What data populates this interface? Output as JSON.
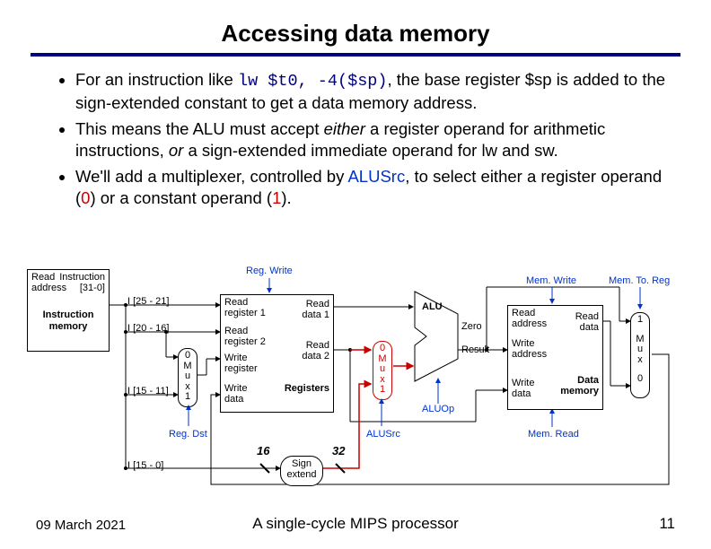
{
  "title": "Accessing data memory",
  "bullet1_a": "For an instruction like ",
  "bullet1_code": "lw $t0, -4($sp)",
  "bullet1_b": ", the base register $sp is added to the sign-extended constant to get a data memory address.",
  "bullet2_a": "This means the ALU must accept ",
  "bullet2_i1": "either",
  "bullet2_b": " a register operand for arithmetic instructions, ",
  "bullet2_i2": "or",
  "bullet2_c": " a sign-extended immediate operand for lw and sw.",
  "bullet3_a": "We'll add a multiplexer, controlled by ",
  "bullet3_ctrl": "ALUSrc",
  "bullet3_b": ", to select either a register operand (",
  "bullet3_zero": "0",
  "bullet3_c": ") or a constant operand (",
  "bullet3_one": "1",
  "bullet3_d": ").",
  "im_readaddr": "Read",
  "im_addr2": "address",
  "im_instr": "Instruction",
  "im_bits": "[31-0]",
  "im_name1": "Instruction",
  "im_name2": "memory",
  "field_rs": "I [25 - 21]",
  "field_rt": "I [20 - 16]",
  "field_rd": "I [15 - 11]",
  "field_imm": "I [15 - 0]",
  "regdst_mux0": "0",
  "regdst_muxM": "M",
  "regdst_muxu": "u",
  "regdst_muxx": "x",
  "regdst_mux1": "1",
  "alusrc_mux0": "0",
  "alusrc_mux1": "1",
  "memreg_mux0": "0",
  "memreg_mux1": "1",
  "rf_rr1": "Read",
  "rf_rr1b": "register 1",
  "rf_rr2": "Read",
  "rf_rr2b": "register 2",
  "rf_wr": "Write",
  "rf_wrb": "register",
  "rf_wd": "Write",
  "rf_wdb": "data",
  "rf_rd1": "Read",
  "rf_rd1b": "data 1",
  "rf_rd2": "Read",
  "rf_rd2b": "data 2",
  "rf_name": "Registers",
  "se_name": "Sign",
  "se_name2": "extend",
  "se_in": "16",
  "se_out": "32",
  "alu_name": "ALU",
  "alu_zero": "Zero",
  "alu_res": "Result",
  "dm_ra": "Read",
  "dm_ra2": "address",
  "dm_wa": "Write",
  "dm_wa2": "address",
  "dm_wd": "Write",
  "dm_wd2": "data",
  "dm_rd": "Read",
  "dm_rd2": "data",
  "dm_name": "Data",
  "dm_name2": "memory",
  "ctrl_regwrite": "Reg. Write",
  "ctrl_regdst": "Reg. Dst",
  "ctrl_alusrc": "ALUSrc",
  "ctrl_aluop": "ALUOp",
  "ctrl_memwrite": "Mem. Write",
  "ctrl_memread": "Mem. Read",
  "ctrl_memtoreg": "Mem. To. Reg",
  "muxM": "M",
  "muxu": "u",
  "muxx": "x",
  "footer_date": "09 March 2021",
  "footer_center": "A single-cycle MIPS processor",
  "footer_page": "11"
}
